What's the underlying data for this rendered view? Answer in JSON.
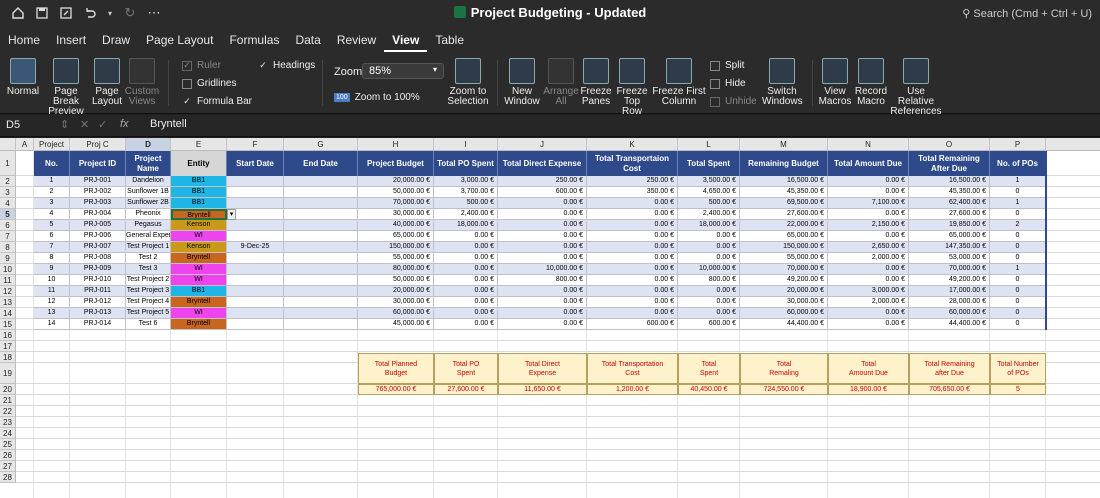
{
  "title": "Project Budgeting - Updated",
  "search_label": "Search (Cmd + Ctrl + U)",
  "menu": [
    "Home",
    "Insert",
    "Draw",
    "Page Layout",
    "Formulas",
    "Data",
    "Review",
    "View",
    "Table"
  ],
  "ribbon": {
    "normal": "Normal",
    "page_break_1": "Page Break",
    "page_break_2": "Preview",
    "page_layout_1": "Page",
    "page_layout_2": "Layout",
    "custom_1": "Custom",
    "custom_2": "Views",
    "ruler": "Ruler",
    "gridlines": "Gridlines",
    "formula_bar": "Formula Bar",
    "headings": "Headings",
    "zoom_label": "Zoom",
    "zoom_value": "85%",
    "zoom100": "Zoom to 100%",
    "zoom100_badge": "100",
    "zoom_sel_1": "Zoom to",
    "zoom_sel_2": "Selection",
    "new_window_1": "New",
    "new_window_2": "Window",
    "arrange_1": "Arrange",
    "arrange_2": "All",
    "freeze_panes_1": "Freeze",
    "freeze_panes_2": "Panes",
    "freeze_top_1": "Freeze",
    "freeze_top_2": "Top Row",
    "freeze_first_1": "Freeze First",
    "freeze_first_2": "Column",
    "split": "Split",
    "hide": "Hide",
    "unhide": "Unhide",
    "switch_1": "Switch",
    "switch_2": "Windows",
    "view_macros_1": "View",
    "view_macros_2": "Macros",
    "record_1": "Record",
    "record_2": "Macro",
    "relative_1": "Use Relative",
    "relative_2": "References"
  },
  "formula_bar": {
    "name_box": "D5",
    "fx": "fx",
    "value": "Bryntell"
  },
  "col_letters": [
    "A",
    "B",
    "C",
    "D",
    "E",
    "F",
    "G",
    "H",
    "I",
    "J",
    "K",
    "L",
    "M",
    "N",
    "O",
    "P"
  ],
  "col_overrides": {
    "B": "Project ID",
    "C": "Proj   C"
  },
  "headers": [
    "No.",
    "Project ID",
    "Project Name",
    "Entity",
    "Start Date",
    "End Date",
    "Project Budget",
    "Total PO Spent",
    "Total Direct Expense",
    "Total Transportaion Cost",
    "Total Spent",
    "Remaining Budget",
    "Total Amount Due",
    "Total Remaining After Due",
    "No. of POs"
  ],
  "rows": [
    [
      "1",
      "PRJ-001",
      "Dandelion",
      "BB1",
      "",
      "",
      "20,000.00 €",
      "3,000.00 €",
      "250.00 €",
      "250.00 €",
      "3,500.00 €",
      "16,500.00 €",
      "0.00 €",
      "16,500.00 €",
      "1"
    ],
    [
      "2",
      "PRJ-002",
      "Sunflower 1B",
      "BB1",
      "",
      "",
      "50,000.00 €",
      "3,700.00 €",
      "600.00 €",
      "350.00 €",
      "4,650.00 €",
      "45,350.00 €",
      "0.00 €",
      "45,350.00 €",
      "0"
    ],
    [
      "3",
      "PRJ-003",
      "Sunflower 2B",
      "BB1",
      "",
      "",
      "70,000.00 €",
      "500.00 €",
      "0.00 €",
      "0.00 €",
      "500.00 €",
      "69,500.00 €",
      "7,100.00 €",
      "62,400.00 €",
      "1"
    ],
    [
      "4",
      "PRJ-004",
      "Pheonix",
      "Bryntell",
      "",
      "",
      "30,000.00 €",
      "2,400.00 €",
      "0.00 €",
      "0.00 €",
      "2,400.00 €",
      "27,600.00 €",
      "0.00 €",
      "27,600.00 €",
      "0"
    ],
    [
      "5",
      "PRJ-005",
      "Pegasus",
      "Kenson",
      "",
      "",
      "40,000.00 €",
      "18,000.00 €",
      "0.00 €",
      "0.00 €",
      "18,000.00 €",
      "22,000.00 €",
      "2,150.00 €",
      "19,850.00 €",
      "2"
    ],
    [
      "6",
      "PRJ-006",
      "General Expenditure",
      "WI",
      "",
      "",
      "65,000.00 €",
      "0.00 €",
      "0.00 €",
      "0.00 €",
      "0.00 €",
      "65,000.00 €",
      "0.00 €",
      "65,000.00 €",
      "0"
    ],
    [
      "7",
      "PRJ-007",
      "Test Project 1",
      "Kenson",
      "9-Dec-25",
      "",
      "150,000.00 €",
      "0.00 €",
      "0.00 €",
      "0.00 €",
      "0.00 €",
      "150,000.00 €",
      "2,650.00 €",
      "147,350.00 €",
      "0"
    ],
    [
      "8",
      "PRJ-008",
      "Test 2",
      "Bryntell",
      "",
      "",
      "55,000.00 €",
      "0.00 €",
      "0.00 €",
      "0.00 €",
      "0.00 €",
      "55,000.00 €",
      "2,000.00 €",
      "53,000.00 €",
      "0"
    ],
    [
      "9",
      "PRJ-009",
      "Test 3",
      "WI",
      "",
      "",
      "80,000.00 €",
      "0.00 €",
      "10,000.00 €",
      "0.00 €",
      "10,000.00 €",
      "70,000.00 €",
      "0.00 €",
      "70,000.00 €",
      "1"
    ],
    [
      "10",
      "PRJ-010",
      "Test Project 2",
      "WI",
      "",
      "",
      "50,000.00 €",
      "0.00 €",
      "800.00 €",
      "0.00 €",
      "800.00 €",
      "49,200.00 €",
      "0.00 €",
      "49,200.00 €",
      "0"
    ],
    [
      "11",
      "PRJ-011",
      "Test Project 3",
      "BB1",
      "",
      "",
      "20,000.00 €",
      "0.00 €",
      "0.00 €",
      "0.00 €",
      "0.00 €",
      "20,000.00 €",
      "3,000.00 €",
      "17,000.00 €",
      "0"
    ],
    [
      "12",
      "PRJ-012",
      "Test Project 4",
      "Bryntell",
      "",
      "",
      "30,000.00 €",
      "0.00 €",
      "0.00 €",
      "0.00 €",
      "0.00 €",
      "30,000.00 €",
      "2,000.00 €",
      "28,000.00 €",
      "0"
    ],
    [
      "13",
      "PRJ-013",
      "Test Project 5",
      "WI",
      "",
      "",
      "60,000.00 €",
      "0.00 €",
      "0.00 €",
      "0.00 €",
      "0.00 €",
      "60,000.00 €",
      "0.00 €",
      "60,000.00 €",
      "0"
    ],
    [
      "14",
      "PRJ-014",
      "Test 6",
      "Bryntell",
      "",
      "",
      "45,000.00 €",
      "0.00 €",
      "0.00 €",
      "600.00 €",
      "600.00 €",
      "44,400.00 €",
      "0.00 €",
      "44,400.00 €",
      "0"
    ]
  ],
  "entity_colors": {
    "BB1": "#1fb6e6",
    "Bryntell": "#c8651e",
    "Kenson": "#c99a1a",
    "WI": "#ee44ee"
  },
  "summary_headers": [
    [
      "Total Planned",
      "Budget"
    ],
    [
      "Total PO",
      "Spent"
    ],
    [
      "Total Direct",
      "Expense"
    ],
    [
      "Total Transportation",
      "Cost"
    ],
    [
      "Total",
      "Spent"
    ],
    [
      "Total",
      "Remaling"
    ],
    [
      "Total",
      "Amount Due"
    ],
    [
      "Total Remaining",
      "after Due"
    ],
    [
      "Total Number",
      "of POs"
    ]
  ],
  "summary_values": [
    "765,000.00 €",
    "27,600.00 €",
    "11,650.00 €",
    "1,200.00 €",
    "40,450.00 €",
    "724,550.00 €",
    "18,900.00 €",
    "705,650.00 €",
    "5"
  ]
}
